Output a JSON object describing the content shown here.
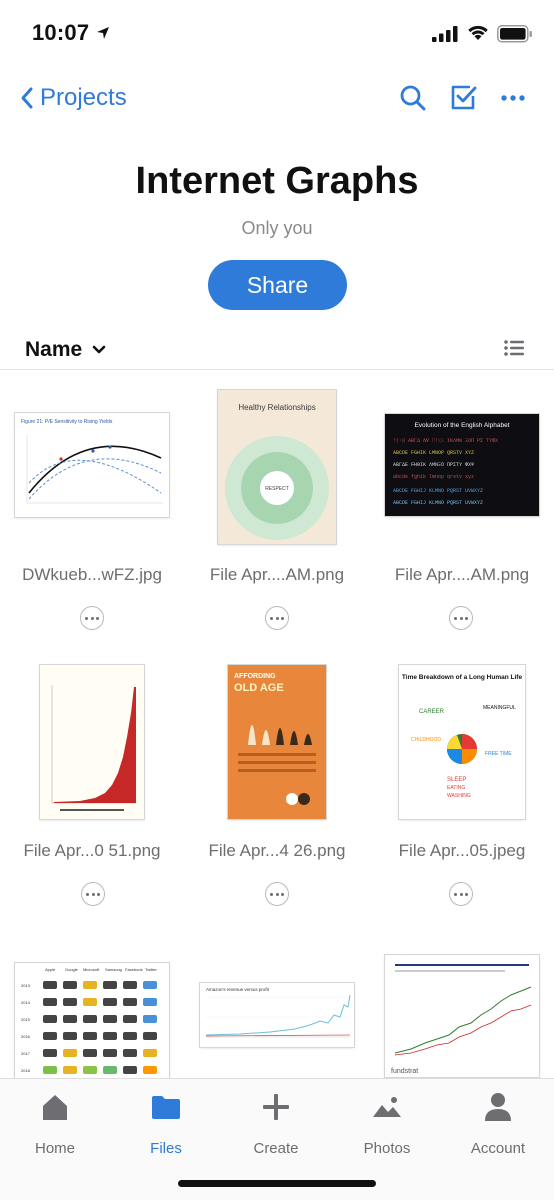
{
  "status": {
    "time": "10:07"
  },
  "nav": {
    "back_label": "Projects"
  },
  "header": {
    "title": "Internet Graphs",
    "subtitle": "Only you",
    "share_label": "Share"
  },
  "sort": {
    "label": "Name"
  },
  "files": [
    {
      "name": "DWkueb...wFZ.jpg",
      "thumb": "pe-chart",
      "thumb_text": "Figure 21: P/E Sensitivity to Rising Yields"
    },
    {
      "name": "File Apr....AM.png",
      "thumb": "healthy-relationships",
      "thumb_text": "Healthy Relationships",
      "thumb_sub": "RESPECT"
    },
    {
      "name": "File Apr....AM.png",
      "thumb": "alphabet",
      "thumb_text": "Evolution of the English Alphabet"
    },
    {
      "name": "File Apr...0 51.png",
      "thumb": "red-bar-chart"
    },
    {
      "name": "File Apr...4 26.png",
      "thumb": "affording-old-age",
      "thumb_text": "AFFORDING",
      "thumb_sub": "OLD AGE"
    },
    {
      "name": "File Apr...05.jpeg",
      "thumb": "time-breakdown",
      "thumb_text": "Time Breakdown of a Long Human Life"
    },
    {
      "name": "",
      "thumb": "gun-grid",
      "thumb_cols": [
        "Apple",
        "Google",
        "Microsoft",
        "Samsung",
        "Facebook",
        "Twitter"
      ],
      "thumb_rows": [
        "2013",
        "2014",
        "2015",
        "2016",
        "2017",
        "2018"
      ]
    },
    {
      "name": "",
      "thumb": "amazon-revenue",
      "thumb_text": "Amazon's revenue versus profit"
    },
    {
      "name": "",
      "thumb": "fundstrat",
      "thumb_text": "fundstrat"
    }
  ],
  "tabs": [
    {
      "label": "Home",
      "icon": "home-icon"
    },
    {
      "label": "Files",
      "icon": "folder-icon",
      "active": true
    },
    {
      "label": "Create",
      "icon": "plus-icon"
    },
    {
      "label": "Photos",
      "icon": "photos-icon"
    },
    {
      "label": "Account",
      "icon": "account-icon"
    }
  ],
  "colors": {
    "accent": "#2f7bd9",
    "muted": "#6d6d72"
  }
}
